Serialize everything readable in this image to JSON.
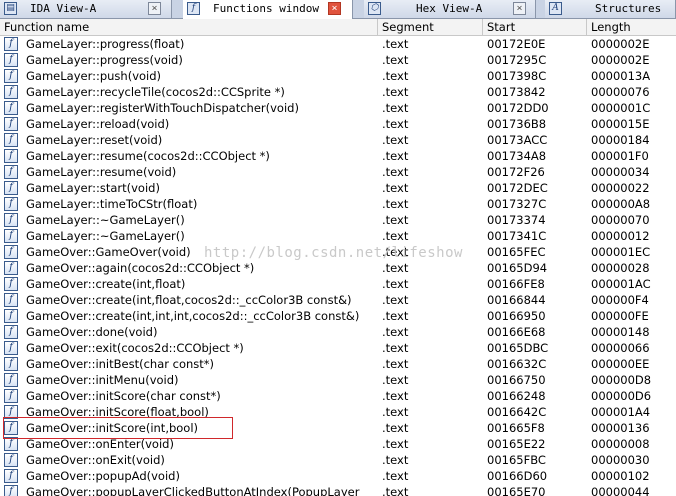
{
  "tabs": [
    {
      "label": "IDA View-A",
      "icon": "ida-view-icon",
      "close": "×"
    },
    {
      "label": "Functions window",
      "icon": "function-icon",
      "glyph": "f",
      "close": "×"
    },
    {
      "label": "Hex View-A",
      "icon": "hex-view-icon",
      "close": "×"
    },
    {
      "label": "Structures",
      "icon": "structures-icon",
      "glyph": "A"
    }
  ],
  "columns": {
    "name": "Function name",
    "segment": "Segment",
    "start": "Start",
    "length": "Length"
  },
  "rows": [
    {
      "name": "GameLayer::progress(float)",
      "segment": ".text",
      "start": "00172E0E",
      "length": "0000002E"
    },
    {
      "name": "GameLayer::progress(void)",
      "segment": ".text",
      "start": "0017295C",
      "length": "0000002E"
    },
    {
      "name": "GameLayer::push(void)",
      "segment": ".text",
      "start": "0017398C",
      "length": "0000013A"
    },
    {
      "name": "GameLayer::recycleTile(cocos2d::CCSprite *)",
      "segment": ".text",
      "start": "00173842",
      "length": "00000076"
    },
    {
      "name": "GameLayer::registerWithTouchDispatcher(void)",
      "segment": ".text",
      "start": "00172DD0",
      "length": "0000001C"
    },
    {
      "name": "GameLayer::reload(void)",
      "segment": ".text",
      "start": "001736B8",
      "length": "0000015E"
    },
    {
      "name": "GameLayer::reset(void)",
      "segment": ".text",
      "start": "00173ACC",
      "length": "00000184"
    },
    {
      "name": "GameLayer::resume(cocos2d::CCObject *)",
      "segment": ".text",
      "start": "001734A8",
      "length": "000001F0"
    },
    {
      "name": "GameLayer::resume(void)",
      "segment": ".text",
      "start": "00172F26",
      "length": "00000034"
    },
    {
      "name": "GameLayer::start(void)",
      "segment": ".text",
      "start": "00172DEC",
      "length": "00000022"
    },
    {
      "name": "GameLayer::timeToCStr(float)",
      "segment": ".text",
      "start": "0017327C",
      "length": "000000A8"
    },
    {
      "name": "GameLayer::~GameLayer()",
      "segment": ".text",
      "start": "00173374",
      "length": "00000070"
    },
    {
      "name": "GameLayer::~GameLayer()",
      "segment": ".text",
      "start": "0017341C",
      "length": "00000012"
    },
    {
      "name": "GameOver::GameOver(void)",
      "segment": ".text",
      "start": "00165FEC",
      "length": "000001EC"
    },
    {
      "name": "GameOver::again(cocos2d::CCObject *)",
      "segment": ".text",
      "start": "00165D94",
      "length": "00000028"
    },
    {
      "name": "GameOver::create(int,float)",
      "segment": ".text",
      "start": "00166FE8",
      "length": "000001AC"
    },
    {
      "name": "GameOver::create(int,float,cocos2d::_ccColor3B  const&)",
      "segment": ".text",
      "start": "00166844",
      "length": "000000F4"
    },
    {
      "name": "GameOver::create(int,int,int,cocos2d::_ccColor3B  const&)",
      "segment": ".text",
      "start": "00166950",
      "length": "000000FE"
    },
    {
      "name": "GameOver::done(void)",
      "segment": ".text",
      "start": "00166E68",
      "length": "00000148"
    },
    {
      "name": "GameOver::exit(cocos2d::CCObject *)",
      "segment": ".text",
      "start": "00165DBC",
      "length": "00000066"
    },
    {
      "name": "GameOver::initBest(char  const*)",
      "segment": ".text",
      "start": "0016632C",
      "length": "000000EE"
    },
    {
      "name": "GameOver::initMenu(void)",
      "segment": ".text",
      "start": "00166750",
      "length": "000000D8"
    },
    {
      "name": "GameOver::initScore(char  const*)",
      "segment": ".text",
      "start": "00166248",
      "length": "000000D6"
    },
    {
      "name": "GameOver::initScore(float,bool)",
      "segment": ".text",
      "start": "0016642C",
      "length": "000001A4"
    },
    {
      "name": "GameOver::initScore(int,bool)",
      "segment": ".text",
      "start": "001665F8",
      "length": "00000136"
    },
    {
      "name": "GameOver::onEnter(void)",
      "segment": ".text",
      "start": "00165E22",
      "length": "00000008"
    },
    {
      "name": "GameOver::onExit(void)",
      "segment": ".text",
      "start": "00165FBC",
      "length": "00000030"
    },
    {
      "name": "GameOver::popupAd(void)",
      "segment": ".text",
      "start": "00166D60",
      "length": "00000102"
    },
    {
      "name": "GameOver::popupLayerClickedButtonAtIndex(PopupLayer",
      "segment": ".text",
      "start": "00165E70",
      "length": "00000044"
    }
  ],
  "highlighted_row_index": 24,
  "watermark": "http://blog.csdn.net/lifeshow",
  "colors": {
    "highlight_border": "#d0282b",
    "tab_active_close": "#e0533d",
    "icon_blue": "#1b3f7a"
  }
}
